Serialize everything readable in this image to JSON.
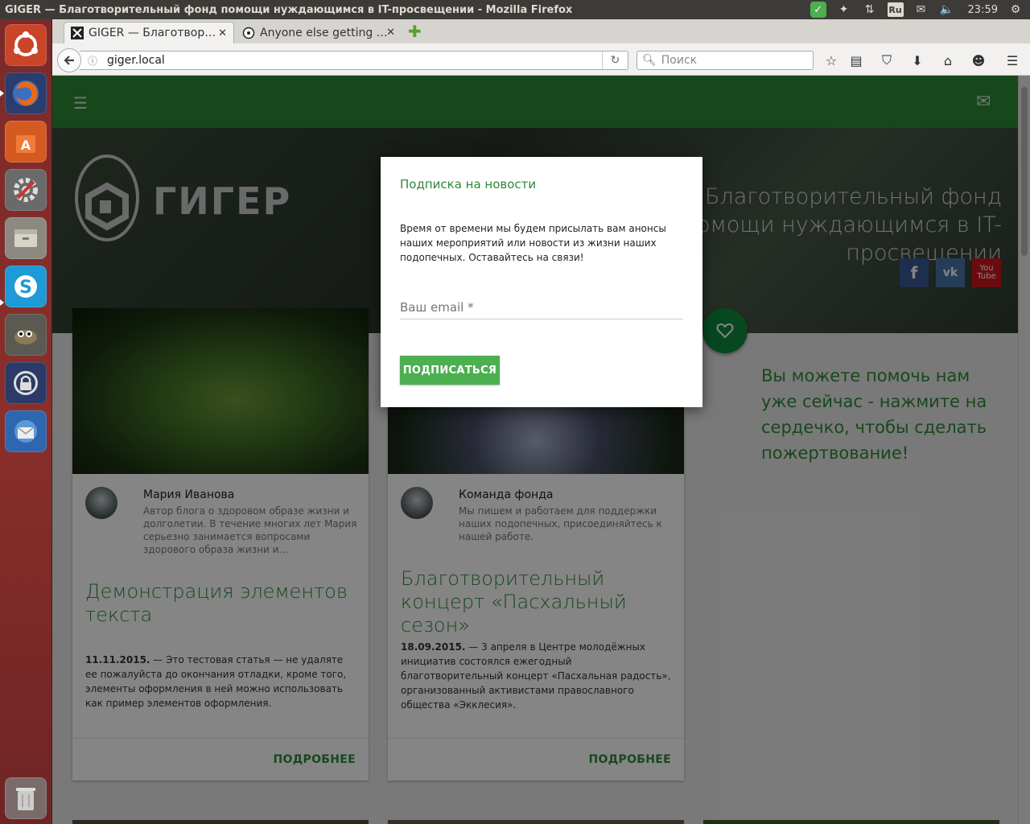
{
  "window": {
    "title": "GIGER — Благотворительный фонд помощи нуждающимся в IT-просвещении - Mozilla Firefox"
  },
  "panel": {
    "lang": "Ru",
    "clock": "23:59"
  },
  "browser": {
    "tabs": [
      {
        "label": "GIGER — Благотвор…",
        "active": true
      },
      {
        "label": "Anyone else getting …",
        "active": false
      }
    ],
    "url": "giger.local",
    "search_placeholder": "Поиск"
  },
  "site": {
    "logo_text": "ГИГЕР",
    "tagline": "Благотворительный фонд помощи нуждающимся в IT-просвещении",
    "aside_text": "Вы можете помочь нам уже сейчас - нажмите на сердечко, чтобы сделать пожертвование!",
    "social": [
      "facebook",
      "vk",
      "youtube"
    ],
    "social_labels": {
      "facebook": "f",
      "vk": "vk",
      "youtube": "You Tube"
    }
  },
  "cards": [
    {
      "author": "Мария Иванова",
      "bio": "Автор блога о здоровом образе жизни и долголетии. В течение многих лет Мария серьезно занимается вопросами здорового образа жизни и…",
      "title": "Демонстрация элементов текста",
      "date": "11.11.2015.",
      "excerpt": " — Это тестовая статья — не удаляте ее пожалуйста до окончания отладки, кроме того, элементы оформления в ней можно использовать как пример элементов оформления.",
      "more": "ПОДРОБНЕЕ"
    },
    {
      "author": "Команда фонда",
      "bio": "Мы пишем и работаем для поддержки наших подопечных, присоединяйтесь к нашей работе.",
      "title": "Благотворительный концерт «Пасхальный сезон»",
      "date": "18.09.2015.",
      "excerpt": " — 3 апреля в Центре молодёжных инициатив состоялся ежегодный благотворительный концерт «Пасхальная радость», организованный активистами православного общества «Экклесия».",
      "more": "ПОДРОБНЕЕ"
    }
  ],
  "modal": {
    "title": "Подписка на новости",
    "text": "Время от времени мы будем присылать вам анонсы наших мероприятий или новости из жизни наших подопечных. Оставайтесь на связи!",
    "email_placeholder": "Ваш email *",
    "submit_label": "ПОДПИСАТЬСЯ"
  },
  "colors": {
    "brand_green": "#2d8a36",
    "button_green": "#4caf50",
    "heart_green": "#0f8a3e"
  }
}
